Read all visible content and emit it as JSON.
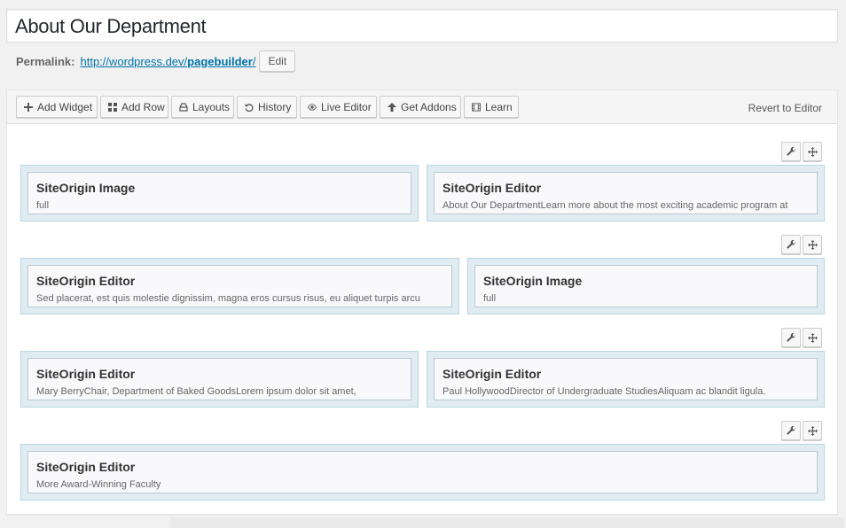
{
  "post_title": "About Our Department",
  "permalink": {
    "label": "Permalink:",
    "url_base": "http://wordpress.dev/",
    "slug": "pagebuilder",
    "trailing": "/",
    "edit_label": "Edit"
  },
  "toolbar": {
    "add_widget": "Add Widget",
    "add_row": "Add Row",
    "layouts": "Layouts",
    "history": "History",
    "live_editor": "Live Editor",
    "get_addons": "Get Addons",
    "learn": "Learn",
    "revert": "Revert to Editor"
  },
  "rows": [
    {
      "cells": [
        {
          "title": "SiteOrigin Image",
          "desc": "full"
        },
        {
          "title": "SiteOrigin Editor",
          "desc": "About Our DepartmentLearn more about the most exciting academic program at"
        }
      ]
    },
    {
      "cells": [
        {
          "title": "SiteOrigin Editor",
          "desc": "Sed placerat, est quis molestie dignissim, magna eros cursus risus, eu aliquet turpis arcu"
        },
        {
          "title": "SiteOrigin Image",
          "desc": "full"
        }
      ]
    },
    {
      "cells": [
        {
          "title": "SiteOrigin Editor",
          "desc": "Mary BerryChair, Department of Baked GoodsLorem ipsum dolor sit amet,"
        },
        {
          "title": "SiteOrigin Editor",
          "desc": "Paul HollywoodDirector of Undergraduate StudiesAliquam ac blandit ligula."
        }
      ]
    },
    {
      "cells": [
        {
          "title": "SiteOrigin Editor",
          "desc": "More Award-Winning Faculty"
        }
      ]
    }
  ]
}
